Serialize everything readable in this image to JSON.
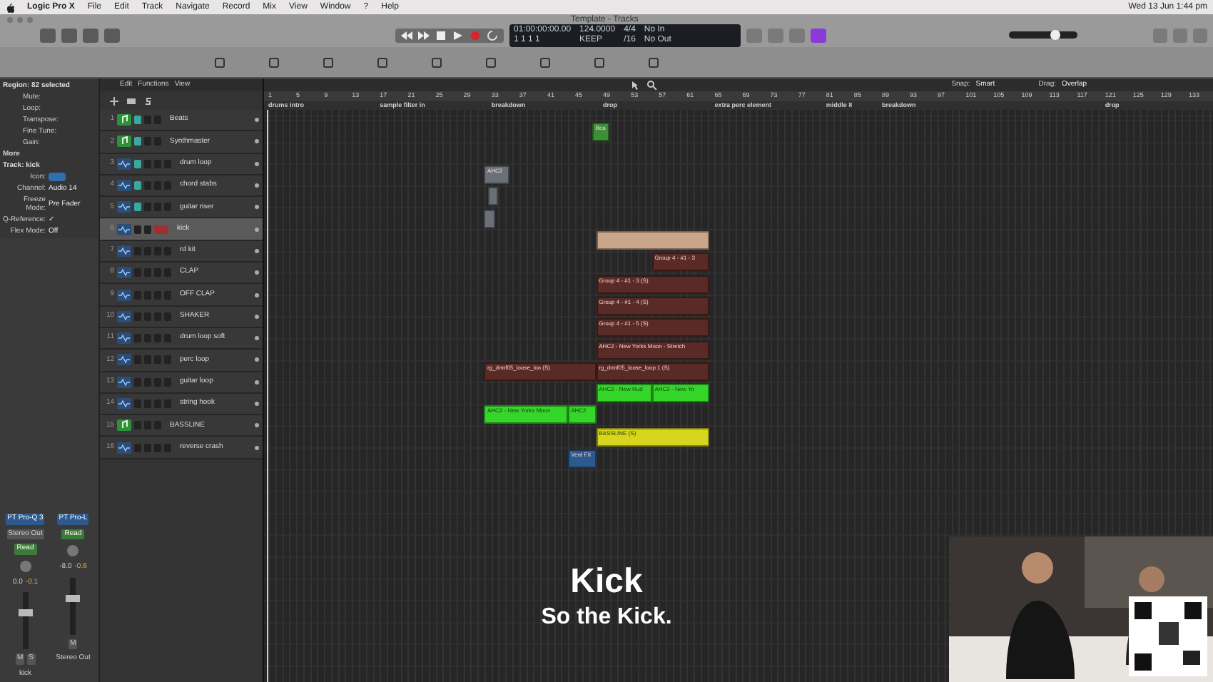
{
  "menu_bar": {
    "app": "Logic Pro X",
    "items": [
      "File",
      "Edit",
      "Track",
      "Navigate",
      "Record",
      "Mix",
      "View",
      "Window",
      "?",
      "Help"
    ],
    "clock": "Wed 13 Jun 1:44 pm"
  },
  "window": {
    "title": "Template - Tracks"
  },
  "lcd": {
    "time": "01:00:00:00.00",
    "bars": "1  1  1     1",
    "tempo": "124.0000",
    "tempo_mode": "KEEP",
    "signature": "4/4",
    "division": "/16",
    "input": "No In",
    "output": "No Out"
  },
  "arrange_menu": [
    "Edit",
    "Functions",
    "View"
  ],
  "snap": {
    "label": "Snap:",
    "value": "Smart"
  },
  "drag": {
    "label": "Drag:",
    "value": "Overlap"
  },
  "master_volume": {
    "level": 0.7
  },
  "inspector": {
    "region_header": "Region: 82 selected",
    "region_fields": [
      "Mute:",
      "Loop:",
      "Transpose:",
      "Fine Tune:",
      "Gain:"
    ],
    "more": "More",
    "track_header": "Track: kick",
    "track_fields": [
      {
        "label": "Icon:"
      },
      {
        "label": "Channel:",
        "value": "Audio 14"
      },
      {
        "label": "Freeze Mode:",
        "value": "Pre Fader"
      },
      {
        "label": "Q-Reference:",
        "value": "✓"
      },
      {
        "label": "Flex Mode:",
        "value": "Off"
      }
    ]
  },
  "channel_strips": [
    {
      "plugin": "PT Pro-Q 3",
      "output": "Stereo Out",
      "automation": "Read",
      "volume": "0.0",
      "peak": "-0.1",
      "name": "kick",
      "buttons": [
        "M",
        "S"
      ]
    },
    {
      "plugin": "PT Pro-L",
      "automation": "Read",
      "volume": "-8.0",
      "peak": "-0.6",
      "name": "Stereo Out",
      "buttons": [
        "M"
      ]
    }
  ],
  "ruler": {
    "bars": [
      "1",
      "5",
      "9",
      "13",
      "17",
      "21",
      "25",
      "29",
      "33",
      "37",
      "41",
      "45",
      "49",
      "53",
      "57",
      "61",
      "65",
      "69",
      "73",
      "77",
      "81",
      "85",
      "89",
      "93",
      "97",
      "101",
      "105",
      "109",
      "113",
      "117",
      "121",
      "125",
      "129",
      "133"
    ]
  },
  "markers": [
    {
      "label": "drums intro"
    },
    {
      "label": "sample filter in"
    },
    {
      "label": "breakdown"
    },
    {
      "label": "drop"
    },
    {
      "label": "extra perc element"
    },
    {
      "label": "middle 8"
    },
    {
      "label": "breakdown"
    },
    {
      "label": "drop"
    }
  ],
  "tracks": [
    {
      "number": "1",
      "name": "Beats",
      "kind": "midi",
      "muted": true,
      "selected": false,
      "armed": false
    },
    {
      "number": "2",
      "name": "Synthmaster",
      "kind": "midi",
      "muted": true,
      "selected": false,
      "armed": false
    },
    {
      "number": "3",
      "name": "drum loop",
      "kind": "audio",
      "muted": true,
      "selected": false,
      "armed": false
    },
    {
      "number": "4",
      "name": "chord stabs",
      "kind": "audio",
      "muted": true,
      "selected": false,
      "armed": false
    },
    {
      "number": "5",
      "name": "guitar riser",
      "kind": "audio",
      "muted": true,
      "selected": false,
      "armed": false
    },
    {
      "number": "6",
      "name": "kick",
      "kind": "audio",
      "muted": false,
      "selected": true,
      "armed": true
    },
    {
      "number": "7",
      "name": "rd kit",
      "kind": "audio",
      "muted": false,
      "selected": false,
      "armed": false
    },
    {
      "number": "8",
      "name": "CLAP",
      "kind": "audio",
      "muted": false,
      "selected": false,
      "armed": false
    },
    {
      "number": "9",
      "name": "OFF CLAP",
      "kind": "audio",
      "muted": false,
      "selected": false,
      "armed": false
    },
    {
      "number": "10",
      "name": "SHAKER",
      "kind": "audio",
      "muted": false,
      "selected": false,
      "armed": false
    },
    {
      "number": "11",
      "name": "drum loop soft",
      "kind": "audio",
      "muted": false,
      "selected": false,
      "armed": false
    },
    {
      "number": "12",
      "name": "perc loop",
      "kind": "audio",
      "muted": false,
      "selected": false,
      "armed": false
    },
    {
      "number": "13",
      "name": "guitar loop",
      "kind": "audio",
      "muted": false,
      "selected": false,
      "armed": false
    },
    {
      "number": "14",
      "name": "string hook",
      "kind": "audio",
      "muted": false,
      "selected": false,
      "armed": false
    },
    {
      "number": "15",
      "name": "BASSLINE",
      "kind": "midi",
      "muted": false,
      "selected": false,
      "armed": false
    },
    {
      "number": "16",
      "name": "reverse crash",
      "kind": "audio",
      "muted": false,
      "selected": false,
      "armed": false
    }
  ],
  "regions": [
    {
      "color": "#3f8f3a",
      "label": "Bea"
    },
    {
      "color": "#6b7078",
      "label": "AHC2"
    },
    {
      "color": "#6b7078"
    },
    {
      "color": "#6b7078"
    },
    {
      "color": "#c9a58a"
    },
    {
      "color": "#5a2a26",
      "label": "Group 4 - #1 - 3"
    },
    {
      "color": "#5a2a26",
      "label": "Group 4 - #1 - 3 (S)"
    },
    {
      "color": "#5a2a26",
      "label": "Group 4 - #1 - 4 (S)"
    },
    {
      "color": "#5a2a26",
      "label": "Group 4 - #1 - 5 (S)"
    },
    {
      "color": "#5a2a26",
      "label": "AHC2 - New Yorks Moon - Stretch"
    },
    {
      "color": "#5a2a26",
      "label": "rg_drmf05_loose_loo (S)"
    },
    {
      "color": "#5a2a26",
      "label": "rg_drmf05_loose_loop 1 (S)"
    },
    {
      "color": "#35d62a",
      "label": "AHC2 - New Rud"
    },
    {
      "color": "#35d62a",
      "label": "AHC2 - New Yo"
    },
    {
      "color": "#35d62a",
      "label": "AHC2 - New Yorks Moon"
    },
    {
      "color": "#35d62a",
      "label": "AHC2"
    },
    {
      "color": "#d7d51e",
      "label": "BASSLINE (S)"
    },
    {
      "color": "#2d5a8e",
      "label": "Vent FX"
    }
  ],
  "subtitles": {
    "title": "Kick",
    "line": "So the Kick."
  }
}
